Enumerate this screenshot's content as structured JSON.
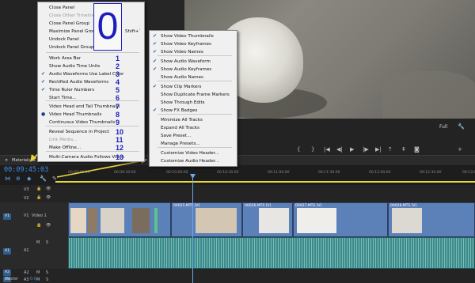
{
  "panel_menu": {
    "items": [
      {
        "label": "Close Panel",
        "disabled": false
      },
      {
        "label": "Close Other Timeline Panels",
        "disabled": true
      },
      {
        "label": "Close Panel Group",
        "disabled": false
      },
      {
        "label": "Maximize Panel Group",
        "disabled": false,
        "shortcut": "Shift+`"
      },
      {
        "label": "Undock Panel",
        "disabled": false
      },
      {
        "label": "Undock Panel Group",
        "disabled": false
      },
      {
        "label": "Work Area Bar",
        "disabled": false,
        "checked": false,
        "num": "1"
      },
      {
        "label": "Show Audio Time Units",
        "disabled": false,
        "checked": false,
        "num": "2"
      },
      {
        "label": "Audio Waveforms Use Label Color",
        "disabled": false,
        "checked": true,
        "num": "3"
      },
      {
        "label": "Rectified Audio Waveforms",
        "disabled": false,
        "checked": true,
        "num": "4"
      },
      {
        "label": "Time Ruler Numbers",
        "disabled": false,
        "checked": true,
        "num": "5"
      },
      {
        "label": "Start Time...",
        "disabled": false,
        "num": "6"
      },
      {
        "label": "Video Head and Tail Thumbnails",
        "disabled": false,
        "num": "7"
      },
      {
        "label": "Video Head Thumbnails",
        "disabled": false,
        "radio": true,
        "num": "8"
      },
      {
        "label": "Continuous Video Thumbnails",
        "disabled": false,
        "num": "9"
      },
      {
        "label": "Reveal Sequence in Project",
        "disabled": false,
        "num": "10"
      },
      {
        "label": "Link Media...",
        "disabled": true,
        "num": "11"
      },
      {
        "label": "Make Offline...",
        "disabled": false,
        "num": "12"
      },
      {
        "label": "Multi-Camera Audio Follows Video",
        "disabled": false,
        "num": "13"
      }
    ],
    "big_number": "0"
  },
  "settings_menu": {
    "items": [
      {
        "label": "Show Video Thumbnails",
        "checked": true
      },
      {
        "label": "Show Video Keyframes",
        "checked": true
      },
      {
        "label": "Show Video Names",
        "checked": true
      },
      {
        "label": "Show Audio Waveform",
        "checked": true
      },
      {
        "label": "Show Audio Keyframes",
        "checked": true
      },
      {
        "label": "Show Audio Names",
        "checked": false
      },
      {
        "label": "Show Clip Markers",
        "checked": true
      },
      {
        "label": "Show Duplicate Frame Markers",
        "checked": false
      },
      {
        "label": "Show Through Edits",
        "checked": false
      },
      {
        "label": "Show FX Badges",
        "checked": true
      },
      {
        "label": "Minimize All Tracks",
        "checked": false
      },
      {
        "label": "Expand All Tracks",
        "checked": false
      },
      {
        "label": "Save Preset...",
        "checked": false
      },
      {
        "label": "Manage Presets...",
        "checked": false
      },
      {
        "label": "Customize Video Header...",
        "checked": false
      },
      {
        "label": "Customize Audio Header...",
        "checked": false
      }
    ]
  },
  "monitor": {
    "resolution": "Full",
    "wrench": "wrench-icon"
  },
  "timeline": {
    "tab": "Materials",
    "timecode": "00:09:45:03",
    "ruler": [
      "00:09:00:00",
      "00:09:30:00",
      "00:10:00:00",
      "00:10:30:00",
      "00:11:00:00",
      "00:11:30:00",
      "00:12:00:00",
      "00:12:30:00",
      "00:13:00:00"
    ],
    "video_tracks": [
      "V3",
      "V2",
      "V1"
    ],
    "v1_name": "Video 1",
    "audio_tracks": [
      "A1",
      "A2",
      "A3"
    ],
    "master": "Master",
    "master_value": "0.0",
    "clips": [
      "00025.MTS [V]",
      "00026.MTS [V]",
      "00027.MTS [V]",
      "00028.MTS [V]"
    ],
    "track_btns": {
      "m": "M",
      "s": "S"
    }
  },
  "colors": {
    "accent": "#3e8ee6",
    "clip_video": "#5c80b8",
    "clip_audio": "#3d8a8b",
    "annotation": "#1d1dbf",
    "yellow_arrow": "#e9d73a"
  }
}
